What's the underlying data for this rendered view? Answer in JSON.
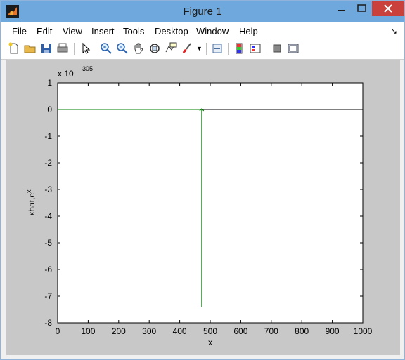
{
  "window": {
    "title": "Figure 1"
  },
  "menu": [
    "File",
    "Edit",
    "View",
    "Insert",
    "Tools",
    "Desktop",
    "Window",
    "Help"
  ],
  "toolbar": {
    "icons": [
      "new-figure-icon",
      "open-icon",
      "save-icon",
      "print-icon",
      "pointer-icon",
      "zoom-in-icon",
      "zoom-out-icon",
      "pan-icon",
      "rotate-3d-icon",
      "data-cursor-icon",
      "brush-icon",
      "link-plot-icon",
      "colorbar-icon",
      "legend-icon",
      "hide-plot-tools-icon",
      "show-plot-tools-icon"
    ]
  },
  "colors": {
    "series_line": "#008000",
    "zero_line": "#000000",
    "background": "#c8c8c8"
  },
  "chart_data": {
    "type": "line",
    "xlabel": "x",
    "ylabel": "xhat,e",
    "ylabel_superscript": "x",
    "exponent_label": "x 10",
    "exponent_value": "305",
    "xlim": [
      0,
      1000
    ],
    "ylim": [
      -8,
      1
    ],
    "xticks": [
      "0",
      "100",
      "200",
      "300",
      "400",
      "500",
      "600",
      "700",
      "800",
      "900",
      "1000"
    ],
    "yticks": [
      "1",
      "0",
      "-1",
      "-2",
      "-3",
      "-4",
      "-5",
      "-6",
      "-7",
      "-8"
    ],
    "series": [
      {
        "x": [
          0,
          472
        ],
        "y": [
          0,
          0
        ]
      },
      {
        "x": [
          472,
          472
        ],
        "y": [
          0,
          -7.4
        ]
      },
      {
        "x": [
          472,
          1000
        ],
        "y": [
          0,
          0
        ]
      }
    ]
  }
}
